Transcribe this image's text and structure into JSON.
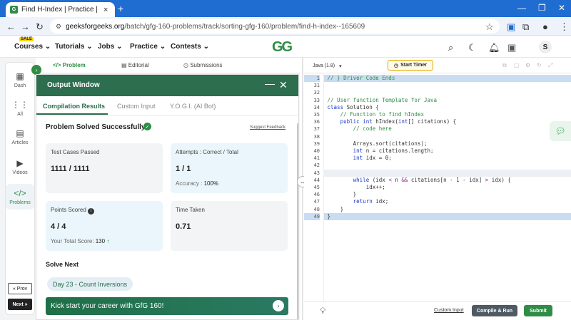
{
  "browser": {
    "tab_title": "Find H-Index | Practice | GeeksforGeeks",
    "new_tab": "+",
    "url_host": "geeksforgeeks.org",
    "url_path": "/batch/gfg-160-problems/track/sorting-gfg-160/problem/find-h-index--165609"
  },
  "nav": {
    "sale_badge": "SALE",
    "items": [
      "Courses",
      "Tutorials",
      "Jobs",
      "Practice",
      "Contests"
    ],
    "logo": "GG",
    "avatar": "S"
  },
  "sidebar": {
    "items": [
      {
        "label": "Dash",
        "icon": "dashboard-icon",
        "glyph": "▦"
      },
      {
        "label": "All",
        "icon": "grid-icon",
        "glyph": "⋮⋮"
      },
      {
        "label": "Articles",
        "icon": "article-icon",
        "glyph": "▤"
      },
      {
        "label": "Videos",
        "icon": "video-icon",
        "glyph": "▶"
      },
      {
        "label": "Problems",
        "icon": "code-icon",
        "glyph": "</>"
      }
    ],
    "prev": "« Prov",
    "next": "Next »"
  },
  "problem_tabs": {
    "problem": "</> Problem",
    "editorial": "Editorial",
    "submissions": "Submissions"
  },
  "output": {
    "title": "Output Window",
    "tabs": [
      "Compilation Results",
      "Custom Input",
      "Y.O.G.I. (AI Bot)"
    ],
    "status": "Problem Solved Successfully",
    "suggest_feedback": "Suggest Feedback",
    "cards": {
      "test_cases": {
        "label": "Test Cases Passed",
        "value": "1111 / 1111"
      },
      "attempts": {
        "label": "Attempts : Correct / Total",
        "value": "1 / 1",
        "sub_label": "Accuracy :",
        "sub_value": "100%"
      },
      "points": {
        "label": "Points Scored",
        "value": "4 / 4",
        "sub_label": "Your Total Score:",
        "sub_value": "130"
      },
      "time": {
        "label": "Time Taken",
        "value": "0.71"
      }
    },
    "solve_next": "Solve Next",
    "next_problem": "Day 23 - Count Inversions",
    "banner": "Kick start your career with GfG 160!"
  },
  "editor": {
    "language": "Java (1.8)",
    "timer": "Start Timer",
    "lines": [
      {
        "n": "1",
        "code": "// } Driver Code Ends",
        "hl": true
      },
      {
        "n": "31",
        "code": ""
      },
      {
        "n": "32",
        "code": ""
      },
      {
        "n": "33",
        "code": "// User function Template for Java"
      },
      {
        "n": "34",
        "code": "class Solution {"
      },
      {
        "n": "35",
        "code": "    // Function to find hIndex"
      },
      {
        "n": "36",
        "code": "    public int hIndex(int[] citations) {"
      },
      {
        "n": "37",
        "code": "        // code here"
      },
      {
        "n": "38",
        "code": ""
      },
      {
        "n": "39",
        "code": "        Arrays.sort(citations);"
      },
      {
        "n": "40",
        "code": "        int n = citations.length;"
      },
      {
        "n": "41",
        "code": "        int idx = 0;"
      },
      {
        "n": "42",
        "code": ""
      },
      {
        "n": "43",
        "code": "",
        "cursor": true
      },
      {
        "n": "44",
        "code": "        while (idx < n && citations[n - 1 - idx] > idx) {"
      },
      {
        "n": "45",
        "code": "            idx++;"
      },
      {
        "n": "46",
        "code": "        }"
      },
      {
        "n": "47",
        "code": "        return idx;"
      },
      {
        "n": "48",
        "code": "    }"
      },
      {
        "n": "49",
        "code": "}",
        "hl": true
      }
    ],
    "custom_input": "Custom Input",
    "compile_run": "Compile & Run",
    "submit": "Submit"
  }
}
